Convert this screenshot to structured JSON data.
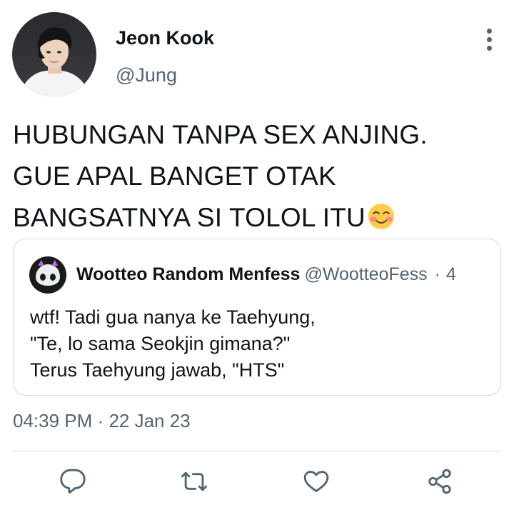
{
  "tweet": {
    "author": {
      "name": "Jeon Kook",
      "handle": "@Jung"
    },
    "text_lines": [
      "HUBUNGAN TANPA SEX ANJING.",
      "GUE APAL BANGET OTAK",
      "BANGSATNYA SI TOLOL ITU"
    ],
    "emoji": "smiling-face-with-blush",
    "timestamp": "04:39 PM",
    "separator": "·",
    "date": "22 Jan 23"
  },
  "quote": {
    "name": "Wootteo Random Menfess",
    "handle": "@WootteoFess",
    "separator": "·",
    "time": "4",
    "text_lines": [
      "wtf! Tadi gua nanya ke Taehyung,",
      "\"Te, lo sama Seokjin gimana?\"",
      "Terus Taehyung jawab, \"HTS\""
    ]
  },
  "actions": [
    {
      "icon": "reply-icon"
    },
    {
      "icon": "retweet-icon"
    },
    {
      "icon": "like-icon"
    },
    {
      "icon": "share-icon"
    }
  ],
  "colors": {
    "text": "#0f1419",
    "secondary": "#536471",
    "border": "#cfd9de"
  }
}
